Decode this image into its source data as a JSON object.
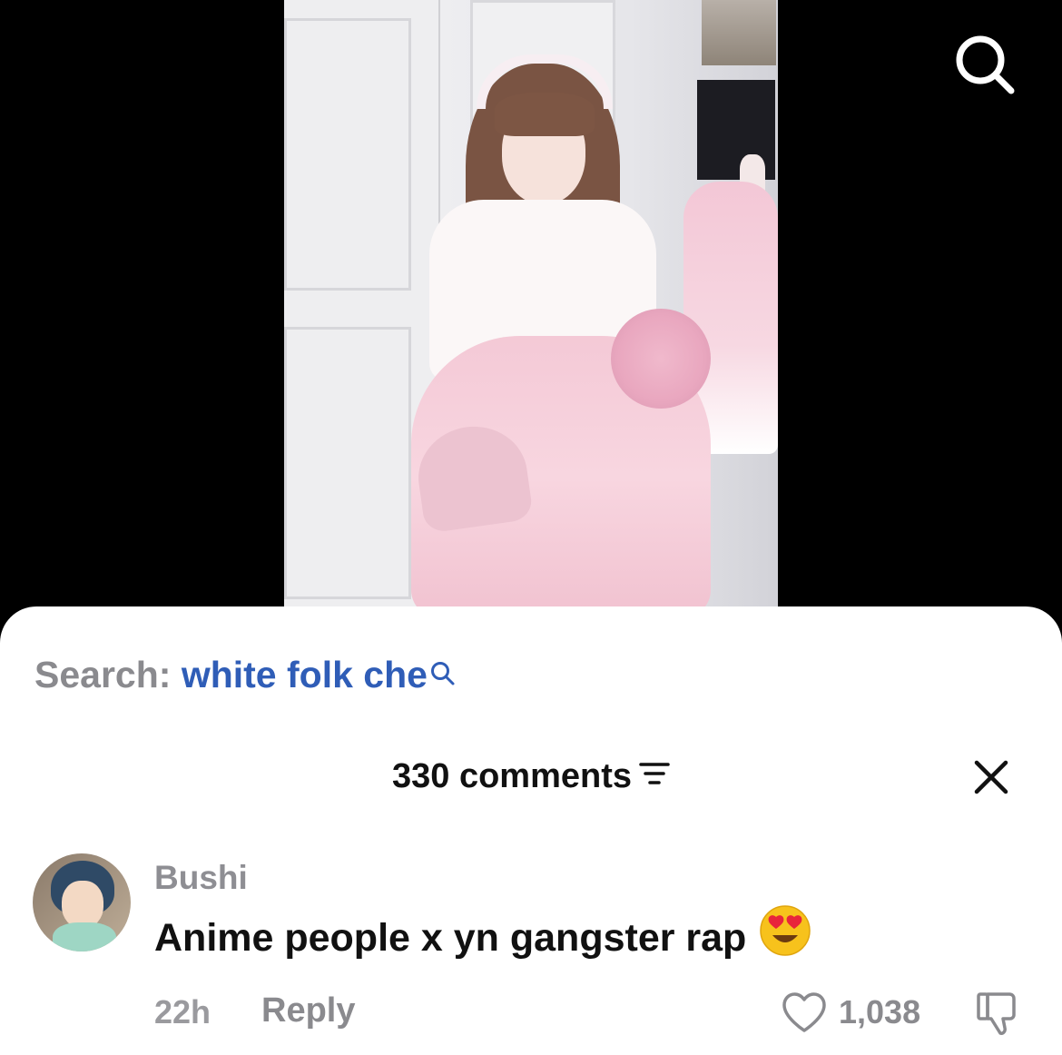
{
  "video": {
    "search_icon": "search-icon"
  },
  "sheet": {
    "search": {
      "prefix": "Search:",
      "query": "white folk che",
      "icon": "search-icon"
    },
    "comments_header": {
      "count_label": "330 comments",
      "filter_icon": "filter-icon",
      "close_icon": "close-icon"
    },
    "comment": {
      "username": "Bushi",
      "text": "Anime people x yn gangster rap",
      "emoji": "heart-eyes-emoji",
      "time": "22h",
      "reply_label": "Reply",
      "likes": "1,038",
      "like_icon": "heart-icon",
      "dislike_icon": "thumbs-down-icon"
    }
  },
  "colors": {
    "search_query": "#2f5db7",
    "muted": "#8a8a8e",
    "text": "#111111",
    "background": "#000000",
    "sheet": "#ffffff"
  }
}
